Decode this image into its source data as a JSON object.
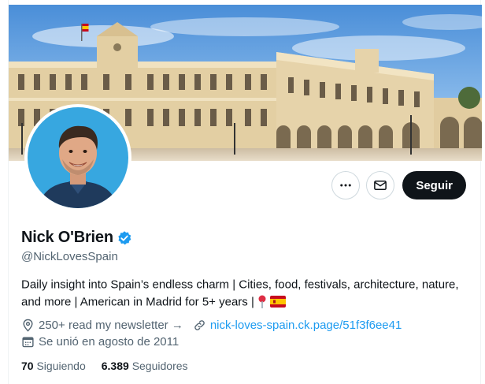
{
  "profile": {
    "name": "Nick O'Brien",
    "handle": "@NickLovesSpain",
    "bio_text": "Daily insight into Spain’s endless charm | Cities, food, festivals, architecture, nature, and more | American in Madrid for 5+ years |",
    "verified": true,
    "newsletter_text": "250+ read my newsletter →",
    "link_text": "nick-loves-spain.ck.page/51f3f6ee41",
    "joined_text": "Se unió en agosto de 2011",
    "following_count": "70",
    "following_label": "Siguiendo",
    "followers_count": "6.389",
    "followers_label": "Seguidores"
  },
  "actions": {
    "more_icon": "more-icon",
    "message_icon": "envelope-icon",
    "follow_label": "Seguir"
  },
  "icons": {
    "verified": "verified-badge-icon",
    "newsletter": "location-pin-icon",
    "link": "link-icon",
    "calendar": "calendar-icon"
  },
  "colors": {
    "accent": "#1d9bf0",
    "text": "#0f1419",
    "muted": "#536471",
    "follow_bg": "#0f1419"
  }
}
